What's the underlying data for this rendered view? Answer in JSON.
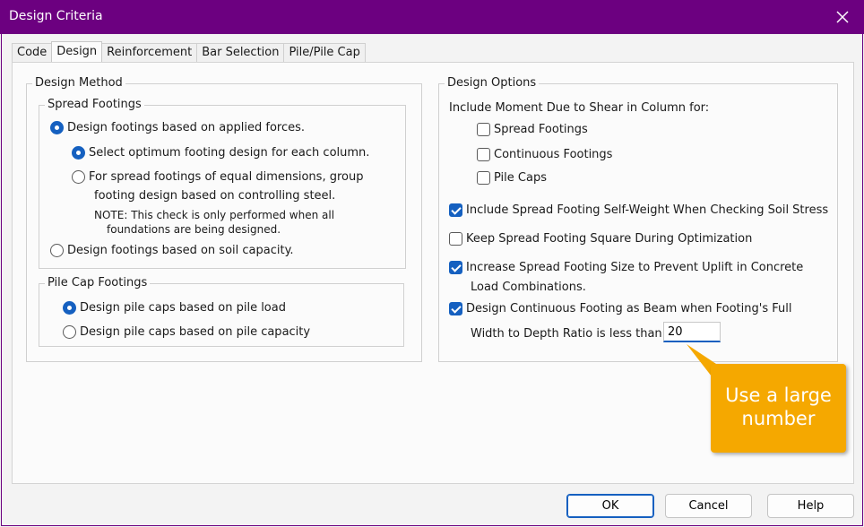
{
  "window": {
    "title": "Design Criteria",
    "close_icon": "close-icon"
  },
  "tabs": [
    {
      "label": "Code",
      "active": false
    },
    {
      "label": "Design",
      "active": true
    },
    {
      "label": "Reinforcement",
      "active": false
    },
    {
      "label": "Bar Selection",
      "active": false
    },
    {
      "label": "Pile/Pile Cap",
      "active": false
    }
  ],
  "design_method": {
    "title": "Design Method",
    "spread_footings": {
      "title": "Spread Footings",
      "opt_applied_forces": {
        "label": "Design footings based on applied forces.",
        "selected": true
      },
      "opt_optimum": {
        "label": "Select optimum footing design for each column.",
        "selected": true
      },
      "opt_equal_dims": {
        "label": "For spread footings of equal dimensions, group",
        "label2": "footing design based on controlling steel.",
        "selected": false
      },
      "note_line1": "NOTE: This check is only performed when all",
      "note_line2": "foundations are being designed.",
      "opt_soil_capacity": {
        "label": "Design footings based on soil capacity.",
        "selected": false
      }
    },
    "pile_cap_footings": {
      "title": "Pile Cap Footings",
      "opt_pile_load": {
        "label": "Design pile caps based on pile load",
        "selected": true
      },
      "opt_pile_capacity": {
        "label": "Design pile caps based on pile capacity",
        "selected": false
      }
    }
  },
  "design_options": {
    "title": "Design Options",
    "include_moment_label": "Include Moment Due to Shear in Column for:",
    "moment_spread": {
      "label": "Spread Footings",
      "checked": false
    },
    "moment_continuous": {
      "label": "Continuous Footings",
      "checked": false
    },
    "moment_pile_caps": {
      "label": "Pile Caps",
      "checked": false
    },
    "self_weight": {
      "label": "Include Spread Footing Self-Weight When Checking Soil Stress",
      "checked": true
    },
    "keep_square": {
      "label": "Keep Spread Footing Square During Optimization",
      "checked": false
    },
    "increase_size": {
      "label": "Increase Spread Footing Size to Prevent Uplift in Concrete",
      "label2": "Load Combinations.",
      "checked": true
    },
    "continuous_beam": {
      "label": "Design Continuous Footing as Beam when Footing's Full",
      "checked": true
    },
    "width_depth_label": "Width to Depth Ratio is less than:",
    "width_depth_value": "20"
  },
  "callout": {
    "line1": "Use a large",
    "line2": "number",
    "color": "#f5a800"
  },
  "buttons": {
    "ok": "OK",
    "cancel": "Cancel",
    "help": "Help"
  },
  "colors": {
    "titlebar": "#6c0080",
    "accent": "#1560c0"
  }
}
